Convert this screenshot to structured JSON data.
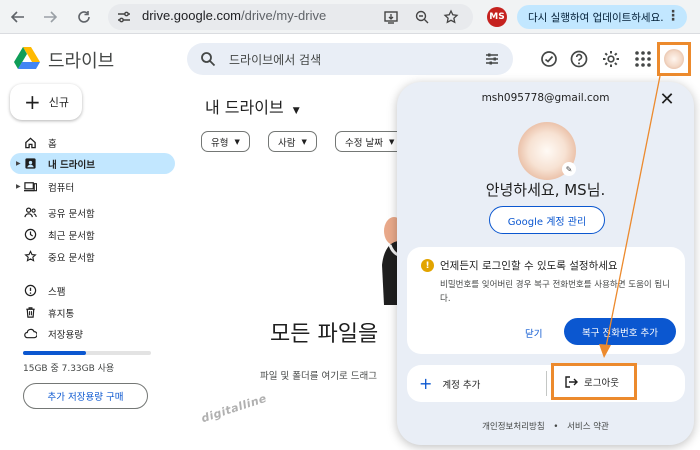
{
  "browser": {
    "url_host": "drive.google.com",
    "url_path": "/drive/my-drive",
    "profile_initials": "MS",
    "update_label": "다시 실행하여 업데이트하세요.",
    "icons": [
      "back-arrow-icon",
      "forward-arrow-icon",
      "reload-icon",
      "site-settings-icon",
      "install-app-icon",
      "zoom-icon",
      "bookmark-star-icon",
      "more-vert-icon"
    ]
  },
  "header": {
    "brand": "드라이브",
    "search_placeholder": "드라이브에서 검색",
    "icons": [
      "search-icon",
      "search-options-icon",
      "offline-ready-icon",
      "help-icon",
      "settings-icon",
      "apps-grid-icon",
      "account-avatar"
    ]
  },
  "sidebar": {
    "new_label": "신규",
    "items": [
      {
        "label": "홈",
        "icon": "home-icon",
        "active": false
      },
      {
        "label": "내 드라이브",
        "icon": "my-drive-icon",
        "active": true
      },
      {
        "label": "컴퓨터",
        "icon": "computer-icon",
        "active": false
      },
      {
        "label": "공유 문서함",
        "icon": "shared-icon",
        "active": false
      },
      {
        "label": "최근 문서함",
        "icon": "recent-icon",
        "active": false
      },
      {
        "label": "중요 문서함",
        "icon": "star-icon",
        "active": false
      },
      {
        "label": "스팸",
        "icon": "spam-icon",
        "active": false
      },
      {
        "label": "휴지통",
        "icon": "trash-icon",
        "active": false
      },
      {
        "label": "저장용량",
        "icon": "cloud-icon",
        "active": false
      }
    ],
    "storage_text": "15GB 중 7.33GB 사용",
    "storage_fraction": 0.49,
    "buy_label": "추가 저장용량 구매"
  },
  "main": {
    "title": "내 드라이브",
    "filters": [
      "유형",
      "사람",
      "수정 날짜"
    ],
    "empty_title": "모든 파일을",
    "empty_sub": "파일 및 폴더를 여기로 드래그",
    "watermark": "digitalline"
  },
  "popup": {
    "email": "msh095778@gmail.com",
    "greeting": "안녕하세요, MS님.",
    "manage_label": "Google 계정 관리",
    "card_title": "언제든지 로그인할 수 있도록 설정하세요",
    "card_desc": "비밀번호를 잊어버린 경우 복구 전화번호를 사용하면 도움이 됩니다.",
    "later_label": "닫기",
    "add_phone_label": "복구 전화번호 추가",
    "add_account_label": "계정 추가",
    "logout_label": "로그아웃",
    "privacy_label": "개인정보처리방침",
    "separator": "•",
    "terms_label": "서비스 약관"
  },
  "colors": {
    "accent": "#0b57d0",
    "highlight": "#ec8a2d",
    "active_nav": "#c2e7ff"
  }
}
